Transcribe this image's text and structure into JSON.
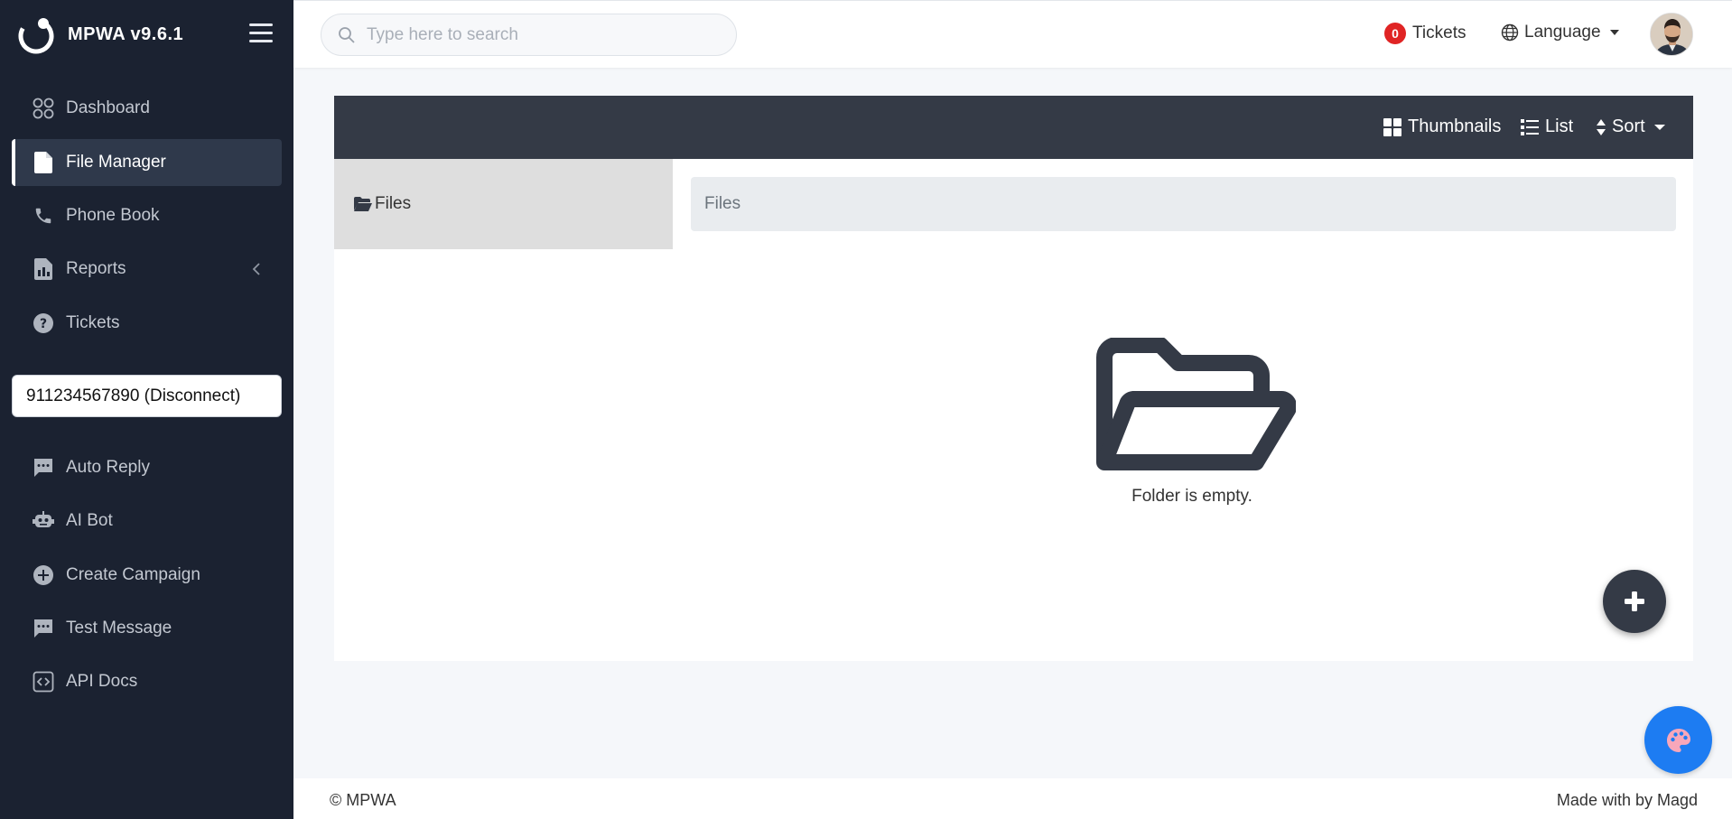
{
  "brand": {
    "name": "MPWA v9.6.1"
  },
  "sidebar": {
    "items": [
      {
        "label": "Dashboard",
        "icon": "dashboard-icon"
      },
      {
        "label": "File Manager",
        "icon": "file-icon",
        "active": true
      },
      {
        "label": "Phone Book",
        "icon": "phone-icon"
      },
      {
        "label": "Reports",
        "icon": "report-icon",
        "has_submenu": true
      },
      {
        "label": "Tickets",
        "icon": "question-circle-icon"
      },
      {
        "label": "Auto Reply",
        "icon": "chat-icon"
      },
      {
        "label": "AI Bot",
        "icon": "robot-icon"
      },
      {
        "label": "Create Campaign",
        "icon": "plus-circle-icon"
      },
      {
        "label": "Test Message",
        "icon": "chat-icon"
      },
      {
        "label": "API Docs",
        "icon": "code-icon"
      }
    ],
    "device": "911234567890 (Disconnect)"
  },
  "topbar": {
    "search_placeholder": "Type here to search",
    "tickets_count": "0",
    "tickets_label": "Tickets",
    "language_label": "Language"
  },
  "file_manager": {
    "view_thumbnails": "Thumbnails",
    "view_list": "List",
    "sort_label": "Sort",
    "tree_root": "Files",
    "breadcrumb": "Files",
    "empty_message": "Folder is empty."
  },
  "footer": {
    "copyright": "© MPWA",
    "credit": "Made with by Magd"
  },
  "colors": {
    "sidebar_bg": "#1b2231",
    "header_bg": "#343a46",
    "badge": "#e02424",
    "palette_button": "#1d7cf2"
  }
}
